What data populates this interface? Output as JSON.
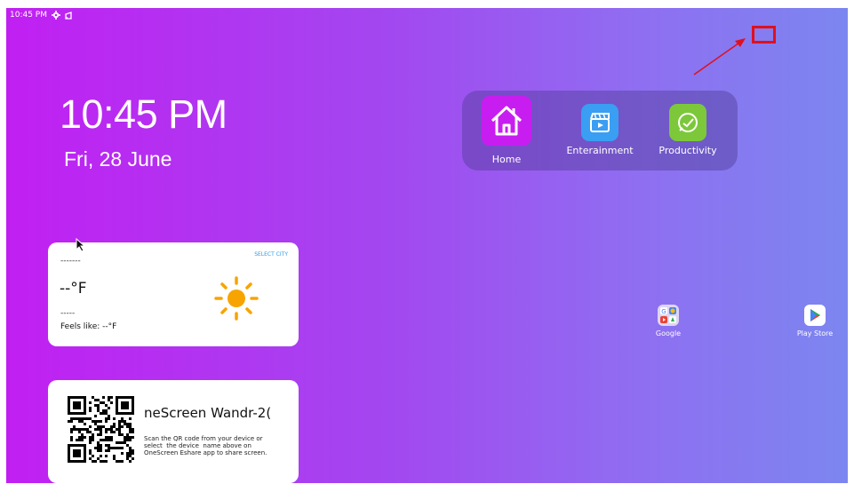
{
  "status_bar": {
    "time": "10:45 PM",
    "icons": [
      "gear-icon",
      "cast-icon"
    ]
  },
  "clock": {
    "time": "10:45 PM",
    "date": "Fri, 28 June"
  },
  "dock": {
    "items": [
      {
        "label": "Home",
        "icon": "home-icon",
        "color": "#c81df0"
      },
      {
        "label": "Enterainment",
        "icon": "clapperboard-icon",
        "color": "#3a9ef3"
      },
      {
        "label": "Productivity",
        "icon": "productivity-icon",
        "color": "#7cc83a"
      }
    ]
  },
  "weather": {
    "select_city": "SELECT CITY",
    "location": "-------",
    "temperature": "--°F",
    "condition": "-----",
    "feels_like": "Feels like: --°F",
    "icon": "sun-icon",
    "icon_color": "#f7a400"
  },
  "share_card": {
    "device_name": "neScreen Wandr-2(",
    "instructions": "Scan the QR code from your device or\nselect  the device  name above on\nOneScreen Eshare app to share screen."
  },
  "desktop_apps": [
    {
      "label": "Google",
      "icon": "google-folder-icon"
    },
    {
      "label": "Play Store",
      "icon": "play-store-icon"
    }
  ],
  "annotation": {
    "color": "#e0101e"
  }
}
